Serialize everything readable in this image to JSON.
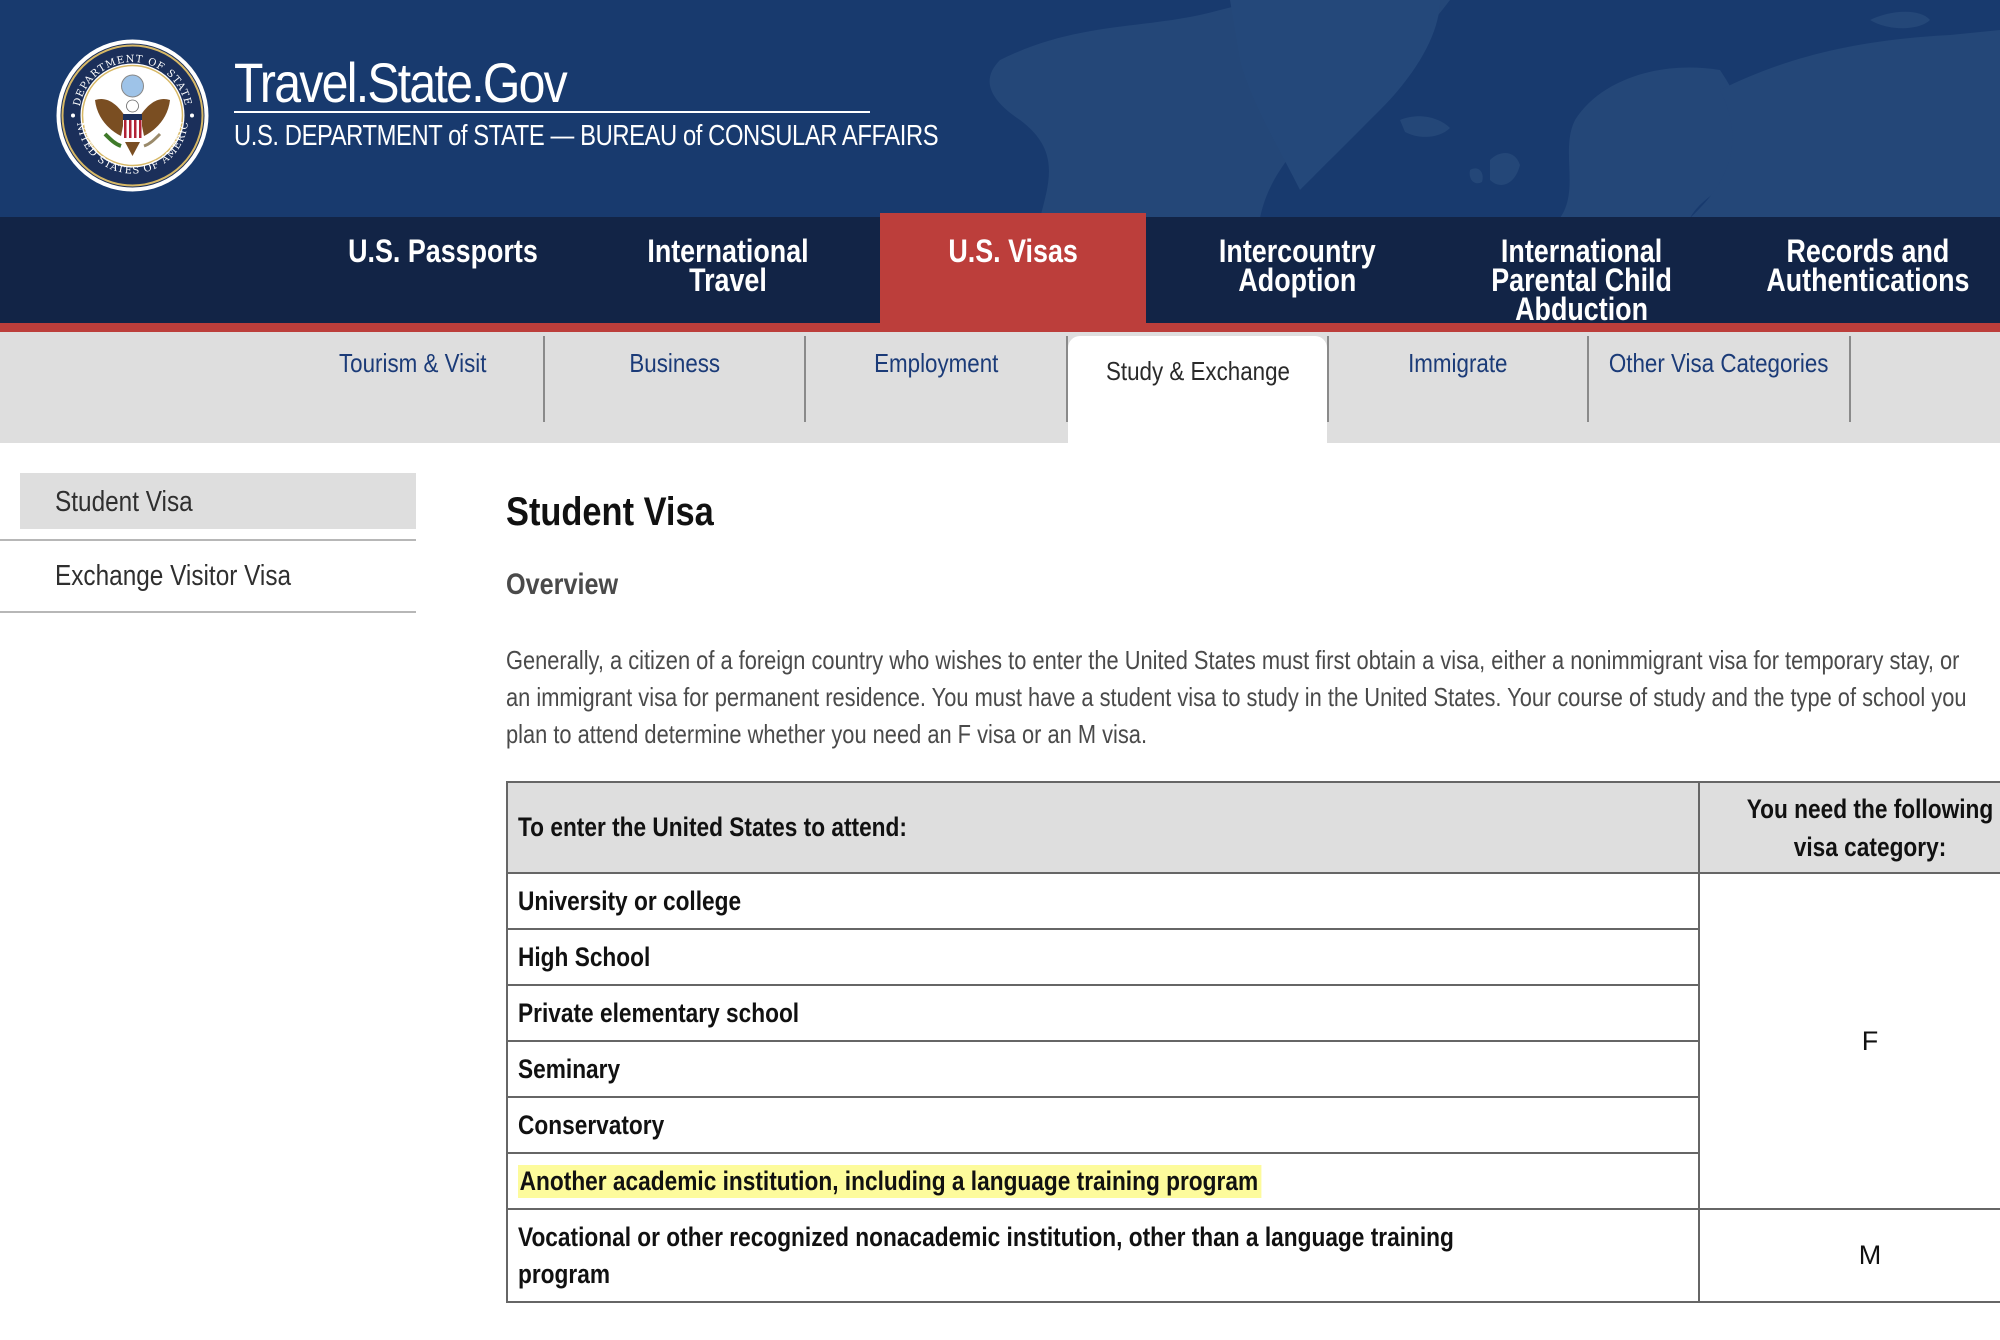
{
  "banner": {
    "site_title": "Travel.State.Gov",
    "site_subtitle": "U.S. DEPARTMENT of STATE — BUREAU of CONSULAR AFFAIRS",
    "seal_icon": "department-of-state-seal-icon",
    "seal_text_top": "DEPARTMENT OF STATE",
    "seal_text_bottom": "UNITED STATES OF AMERICA"
  },
  "colors": {
    "banner_blue": "#183a6e",
    "nav_navy": "#122446",
    "accent_red": "#bc3e3b",
    "subnav_grey": "#dedede",
    "link_blue": "#1b3b78",
    "highlight_yellow": "#fdfb9c"
  },
  "main_nav": {
    "items": [
      {
        "label": "U.S. Passports",
        "active": false
      },
      {
        "label": "International Travel",
        "active": false
      },
      {
        "label": "U.S. Visas",
        "active": true
      },
      {
        "label": "Intercountry\nAdoption",
        "active": false
      },
      {
        "label": "International\nParental Child\nAbduction",
        "active": false
      },
      {
        "label": "Records and\nAuthentications",
        "active": false
      }
    ]
  },
  "sub_nav": {
    "items": [
      {
        "label": "Tourism & Visit",
        "active": false
      },
      {
        "label": "Business",
        "active": false
      },
      {
        "label": "Employment",
        "active": false
      },
      {
        "label": "Study & Exchange",
        "active": true
      },
      {
        "label": "Immigrate",
        "active": false
      },
      {
        "label": "Other Visa Categories",
        "active": false
      }
    ]
  },
  "sidebar": {
    "items": [
      {
        "label": "Student Visa",
        "active": true
      },
      {
        "label": "Exchange Visitor Visa",
        "active": false
      }
    ]
  },
  "content": {
    "title": "Student Visa",
    "section_title": "Overview",
    "intro": "Generally, a citizen of a foreign country who wishes to enter the United States must first obtain a visa, either a nonimmigrant visa for temporary stay, or an immigrant visa for permanent residence. You must have a student visa to study in the United States. Your course of study and the type of school you plan to attend determine whether you need an F visa or an M visa."
  },
  "visa_table": {
    "headers": [
      "To enter the United States to attend:",
      "You need the following visa category:"
    ],
    "rows": [
      {
        "place": "University or college",
        "category": "F"
      },
      {
        "place": "High School",
        "category": "F"
      },
      {
        "place": "Private elementary school",
        "category": "F"
      },
      {
        "place": "Seminary",
        "category": "F"
      },
      {
        "place": "Conservatory",
        "category": "F"
      },
      {
        "place": "Another academic institution, including a language training program",
        "category": "F",
        "highlighted": true
      },
      {
        "place": "Vocational or other recognized nonacademic institution, other than a language training program",
        "category": "M"
      }
    ],
    "category_f": "F",
    "category_m": "M"
  }
}
